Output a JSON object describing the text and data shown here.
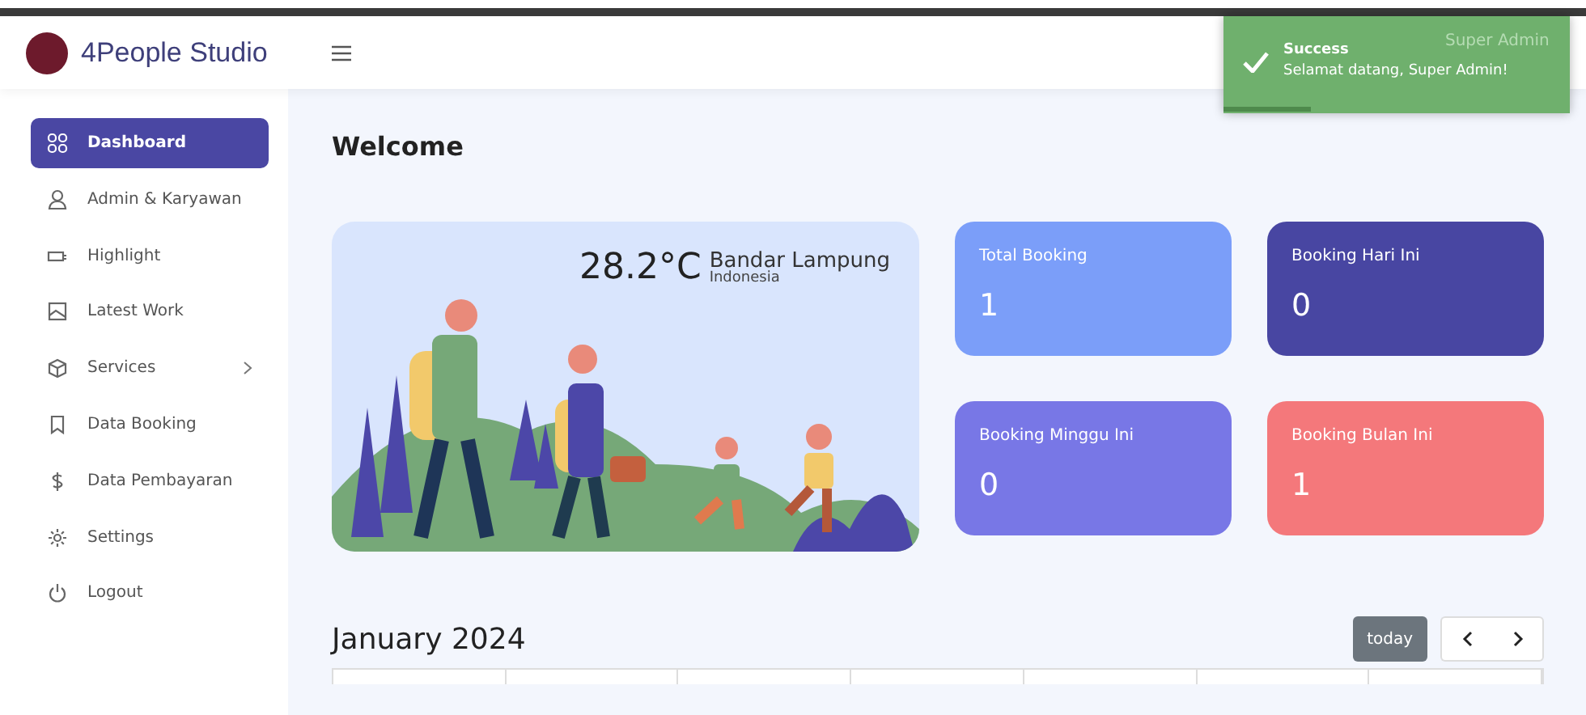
{
  "brand": {
    "name": "4People Studio"
  },
  "navbar": {
    "user": "Super Admin"
  },
  "toast": {
    "title": "Success",
    "message": "Selamat datang, Super Admin!",
    "level": 0.25
  },
  "sidebar": {
    "items": [
      {
        "label": "Dashboard",
        "selected": true,
        "expandable": false
      },
      {
        "label": "Admin & Karyawan",
        "selected": false,
        "expandable": false
      },
      {
        "label": "Highlight",
        "selected": false,
        "expandable": false
      },
      {
        "label": "Latest Work",
        "selected": false,
        "expandable": false
      },
      {
        "label": "Services",
        "selected": false,
        "expandable": true
      },
      {
        "label": "Data Booking",
        "selected": false,
        "expandable": false
      },
      {
        "label": "Data Pembayaran",
        "selected": false,
        "expandable": false
      },
      {
        "label": "Settings",
        "selected": false,
        "expandable": false
      },
      {
        "label": "Logout",
        "selected": false,
        "expandable": false
      }
    ]
  },
  "page_title": "Welcome",
  "weather": {
    "temperature": "28.2°C",
    "city": "Bandar Lampung",
    "country": "Indonesia"
  },
  "stats": [
    {
      "label": "Total Booking",
      "value": "1",
      "color": "#7b9ef9"
    },
    {
      "label": "Booking Hari Ini",
      "value": "0",
      "color": "#4846a2"
    },
    {
      "label": "Booking Minggu Ini",
      "value": "0",
      "color": "#7877e6"
    },
    {
      "label": "Booking Bulan Ini",
      "value": "1",
      "color": "#f4787b"
    }
  ],
  "calendar": {
    "title": "January 2024",
    "today_button": "today"
  }
}
